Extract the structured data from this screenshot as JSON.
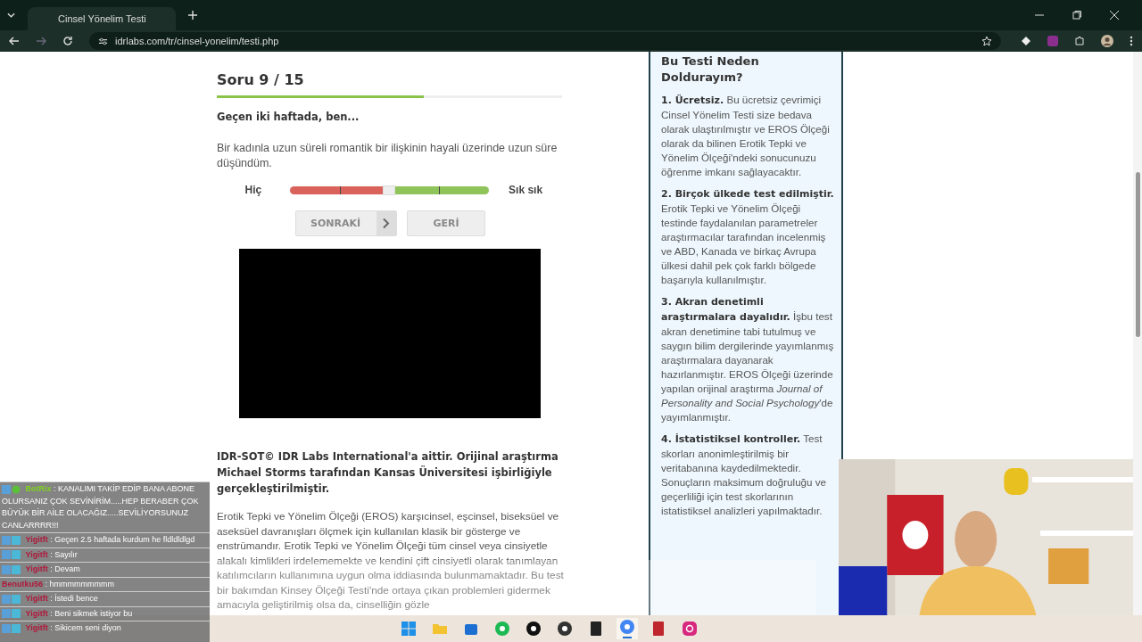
{
  "browser": {
    "tab_title": "Cinsel Yönelim Testi",
    "url": "idrlabs.com/tr/cinsel-yonelim/testi.php"
  },
  "quiz": {
    "title": "Soru 9 / 15",
    "progress": {
      "level": 0.6
    },
    "prompt": "Geçen iki haftada, ben...",
    "statement": "Bir kadınla uzun süreli romantik bir ilişkinin hayali üzerinde uzun süre düşündüm.",
    "scale": {
      "left": "Hiç",
      "right": "Sık sık",
      "level": 0.5
    },
    "buttons": [
      {
        "label": "SONRAKİ",
        "kind": "next"
      },
      {
        "label": "GERİ",
        "kind": "back"
      }
    ]
  },
  "credit": "IDR-SOT© IDR Labs International'a aittir. Orijinal araştırma Michael Storms tarafından Kansas Üniversitesi işbirliğiyle gerçekleştirilmiştir.",
  "description": "Erotik Tepki ve Yönelim Ölçeği (EROS) karşıcinsel, eşcinsel, biseksüel ve aseksüel davranışları ölçmek için kullanılan klasik bir gösterge ve enstrümandır. Erotik Tepki ve Yönelim Ölçeği tüm cinsel veya cinsiyetle alakalı kimlikleri irdelememekte ve kendini çift cinsiyetli olarak tanımlayan katılımcıların kullanımına uygun olma iddiasında bulunmamaktadır. Bu test bir bakımdan Kinsey Ölçeği Testi'nde ortaya çıkan problemleri gidermek amacıyla geliştirilmiş olsa da, cinselliğin gözle",
  "sidebar": {
    "title": "Bu Testi Neden Doldurayım?",
    "items": [
      {
        "heading": "1. Ücretsiz.",
        "text": "Bu ücretsiz çevrimiçi Cinsel Yönelim Testi size bedava olarak ulaştırılmıştır ve EROS Ölçeği olarak da bilinen Erotik Tepki ve Yönelim Ölçeği'ndeki sonucunuzu öğrenme imkanı sağlayacaktır."
      },
      {
        "heading": "2. Birçok ülkede test edilmiştir.",
        "text": "Erotik Tepki ve Yönelim Ölçeği testinde faydalanılan parametreler araştırmacılar tarafından incelenmiş ve ABD, Kanada ve birkaç Avrupa ülkesi dahil pek çok farklı bölgede başarıyla kullanılmıştır."
      },
      {
        "heading": "3. Akran denetimli araştırmalara dayalıdır.",
        "text": "İşbu test akran denetimine tabi tutulmuş ve saygın bilim dergilerinde yayımlanmış araştırmalara dayanarak hazırlanmıştır. EROS Ölçeği üzerinde yapılan orijinal araştırma *Journal of Personality and Social Psychology*'de yayımlanmıştır."
      },
      {
        "heading": "4. İstatistiksel kontroller.",
        "text": "Test skorları anonimleştirilmiş bir veritabanına kaydedilmektedir. Sonuçların maksimum doğruluğu ve geçerliliği için test skorlarının istatistiksel analizleri yapılmaktadır."
      }
    ]
  },
  "chat": [
    {
      "user": "BotRix",
      "color": "#7ed321",
      "kind": "bot",
      "message": ": KANALIMI TAKİP EDİP BANA ABONE OLURSANIZ ÇOK SEVİNİRİM.....HEP BERABER ÇOK BÜYÜK BİR AİLE OLACAĞIZ.....SEVİLİYORSUNUZ CANLARRRR!!!"
    },
    {
      "user": "Yigitft",
      "color": "#b0173a",
      "kind": "subscriber",
      "message": ": Geçen 2.5 haftada kurdum he fldldldlgd"
    },
    {
      "user": "Yigitft",
      "color": "#b0173a",
      "kind": "subscriber",
      "message": ": Sayılır"
    },
    {
      "user": "Yigitft",
      "color": "#b0173a",
      "kind": "subscriber",
      "message": ": Devam"
    },
    {
      "user": "Benutku56",
      "color": "#b0173a",
      "kind": "plain",
      "message": ": hmmmmmmmmm"
    },
    {
      "user": "Yigitft",
      "color": "#b0173a",
      "kind": "subscriber",
      "message": ": İstedi bence"
    },
    {
      "user": "Yigitft",
      "color": "#b0173a",
      "kind": "subscriber",
      "message": ": Beni sikmek istiyor bu"
    },
    {
      "user": "Yigitft",
      "color": "#b0173a",
      "kind": "subscriber",
      "message": ": Sikicem seni diyon"
    }
  ],
  "taskbar": [
    {
      "kind": "start"
    },
    {
      "kind": "folder"
    },
    {
      "kind": "store"
    },
    {
      "kind": "music"
    },
    {
      "kind": "g"
    },
    {
      "kind": "obs"
    },
    {
      "kind": "epic"
    },
    {
      "kind": "chrome",
      "selected": true
    },
    {
      "kind": "voice"
    },
    {
      "kind": "camera"
    }
  ]
}
